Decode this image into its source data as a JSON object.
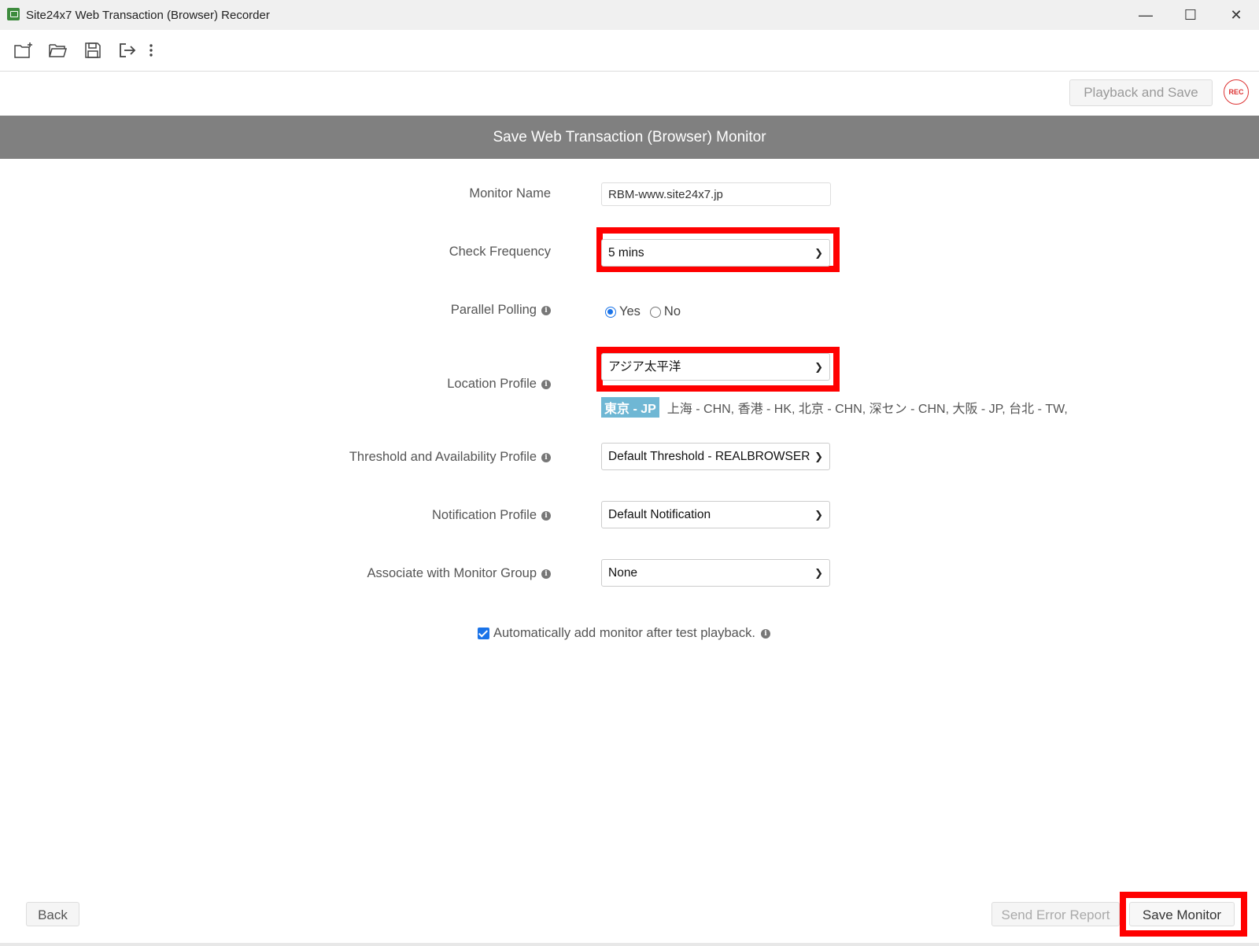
{
  "window": {
    "title": "Site24x7 Web Transaction (Browser) Recorder",
    "minimize": "—",
    "maximize": "☐",
    "close": "✕"
  },
  "toolbar": {
    "icons": [
      "new-folder-icon",
      "open-folder-icon",
      "save-icon",
      "export-icon",
      "more-vertical-icon"
    ]
  },
  "actions": {
    "playback_and_save": "Playback and Save",
    "rec": "REC"
  },
  "header": {
    "title": "Save Web Transaction (Browser) Monitor"
  },
  "form": {
    "monitor_name_label": "Monitor Name",
    "monitor_name_value": "RBM-www.site24x7.jp",
    "check_frequency_label": "Check Frequency",
    "check_frequency_value": "5 mins",
    "parallel_polling_label": "Parallel Polling",
    "parallel_polling_yes": "Yes",
    "parallel_polling_no": "No",
    "parallel_polling_selected": "Yes",
    "location_profile_label": "Location Profile",
    "location_profile_value": "アジア太平洋",
    "location_primary": "東京 - JP",
    "location_others": "上海 - CHN, 香港 - HK, 北京 - CHN, 深セン - CHN, 大阪 - JP, 台北 - TW,",
    "threshold_label": "Threshold and Availability Profile",
    "threshold_value": "Default Threshold - REALBROWSER",
    "notification_label": "Notification Profile",
    "notification_value": "Default Notification",
    "monitor_group_label": "Associate with Monitor Group",
    "monitor_group_value": "None",
    "auto_add_label": "Automatically add monitor after test playback.",
    "auto_add_checked": true
  },
  "footer": {
    "back": "Back",
    "send_error_report": "Send Error Report",
    "save_monitor": "Save Monitor"
  },
  "colors": {
    "header_band": "#808080",
    "highlight": "#ff0000",
    "accent": "#1a73e8",
    "location_tag": "#6fb7d4",
    "rec": "#dd3333"
  }
}
